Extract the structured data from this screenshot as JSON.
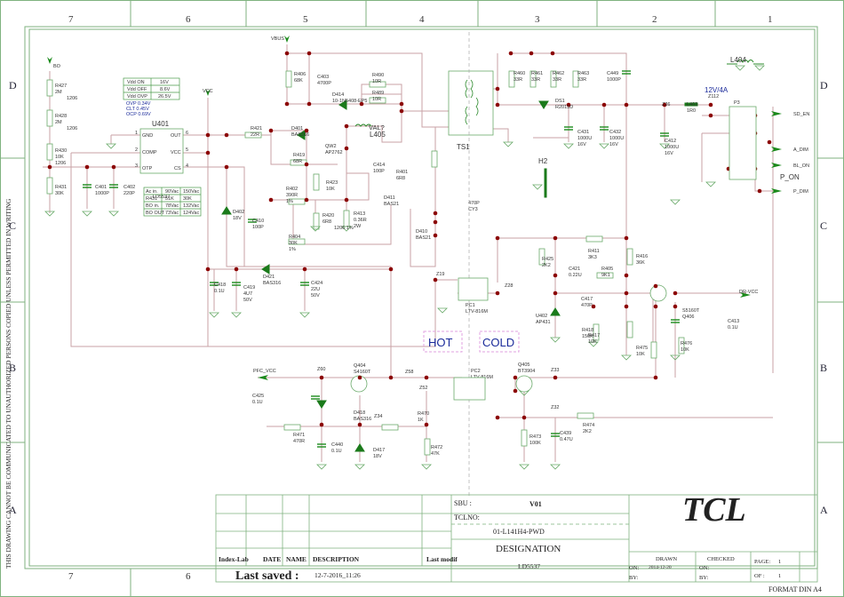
{
  "border": {
    "columns": [
      "7",
      "6",
      "5",
      "4",
      "3",
      "2",
      "1"
    ],
    "rows": [
      "D",
      "C",
      "B",
      "A"
    ],
    "side_notice": "THIS DRAWING CANNOT BE COMMUNICATED TO UNAUTHORIZED PERSONS COPIED UNLESS PERMITTED IN WRITING"
  },
  "nets": {
    "bo": "BO",
    "vbus": "VBUS",
    "vcc": "VCC",
    "pfc_vcc": "PFC_VCC",
    "dr_vcc": "DR-VCC",
    "sd_en": "SD_EN",
    "a_dim": "A_DIM",
    "bl_on": "BL_ON",
    "p_on": "P_ON",
    "p_dim": "P_DIM",
    "rail": "12V/4A",
    "val": "VAL?"
  },
  "regions": {
    "hot": "HOT",
    "cold": "COLD"
  },
  "ic": {
    "ref": "U401",
    "part": "LD5537",
    "pins_left": [
      {
        "num": "1",
        "name": "GND"
      },
      {
        "num": "2",
        "name": "COMP"
      },
      {
        "num": "3",
        "name": "OTP"
      }
    ],
    "pins_right": [
      {
        "num": "6",
        "name": "OUT"
      },
      {
        "num": "5",
        "name": "VCC"
      },
      {
        "num": "4",
        "name": "CS"
      }
    ]
  },
  "vdd_table": [
    [
      "Vdd ON",
      "16V"
    ],
    [
      "Vdd OFF",
      "8.6V"
    ],
    [
      "Vdd OVP",
      "26.5V"
    ]
  ],
  "protect_notes": [
    "OVP 0.34V",
    "CLT 0.45V",
    "OCP 0.69V"
  ],
  "bo_table": [
    [
      "Ac in.",
      "90Vac",
      "150Vac"
    ],
    [
      "R431",
      "51K",
      "30K"
    ],
    [
      "BO in.",
      "78Vac",
      "132Vac"
    ],
    [
      "BO OUT",
      "73Vac",
      "124Vac"
    ]
  ],
  "components": [
    {
      "ref": "R427",
      "value": "2M",
      "extra": "1206"
    },
    {
      "ref": "R428",
      "value": "2M",
      "extra": "1206"
    },
    {
      "ref": "R430",
      "value": "10K",
      "extra": "1206"
    },
    {
      "ref": "R431",
      "value": "30K"
    },
    {
      "ref": "C401",
      "value": "1000P"
    },
    {
      "ref": "C402",
      "value": "220P"
    },
    {
      "ref": "R421",
      "value": "22R"
    },
    {
      "ref": "D401",
      "value": "BAS316"
    },
    {
      "ref": "R419",
      "value": "68R"
    },
    {
      "ref": "QW2",
      "value": "AP2762"
    },
    {
      "ref": "C414",
      "value": "100P"
    },
    {
      "ref": "R402",
      "value": "390R",
      "extra": "1%"
    },
    {
      "ref": "R423",
      "value": "10K"
    },
    {
      "ref": "R420",
      "value": "6R8",
      "extra": "1206 1%"
    },
    {
      "ref": "R413",
      "value": "0.36R",
      "extra": "2W"
    },
    {
      "ref": "R404",
      "value": "30K",
      "extra": "1%"
    },
    {
      "ref": "R406",
      "value": "68K"
    },
    {
      "ref": "C403",
      "value": "4700P"
    },
    {
      "ref": "D414",
      "value": "10-1N5408-EP5"
    },
    {
      "ref": "R490",
      "value": "10R"
    },
    {
      "ref": "R489",
      "value": "10R"
    },
    {
      "ref": "L405",
      "value": ""
    },
    {
      "ref": "R401",
      "value": "6R8"
    },
    {
      "ref": "D411",
      "value": "BAS21"
    },
    {
      "ref": "D410",
      "value": "BAS21"
    },
    {
      "ref": "D402",
      "value": "18V"
    },
    {
      "ref": "C410",
      "value": "100P"
    },
    {
      "ref": "C418",
      "value": "0.1U"
    },
    {
      "ref": "C419",
      "value": "4U7",
      "extra": "50V"
    },
    {
      "ref": "D421",
      "value": "BAS316"
    },
    {
      "ref": "C424",
      "value": "22U",
      "extra": "50V"
    },
    {
      "ref": "TS1",
      "value": ""
    },
    {
      "ref": "470P",
      "value": "CY3"
    },
    {
      "ref": "H2",
      "value": ""
    },
    {
      "ref": "R460",
      "value": "33R"
    },
    {
      "ref": "R461",
      "value": "33R"
    },
    {
      "ref": "R462",
      "value": "33R"
    },
    {
      "ref": "R463",
      "value": "33R"
    },
    {
      "ref": "DS1",
      "value": "R2015D"
    },
    {
      "ref": "C449",
      "value": "1000P"
    },
    {
      "ref": "C431",
      "value": "1000U",
      "extra": "16V"
    },
    {
      "ref": "C432",
      "value": "1000U",
      "extra": "16V"
    },
    {
      "ref": "Z26",
      "value": ""
    },
    {
      "ref": "C412",
      "value": "1000U",
      "extra": "16V"
    },
    {
      "ref": "L403",
      "value": "1R0"
    },
    {
      "ref": "Z112",
      "value": ""
    },
    {
      "ref": "P3",
      "value": ""
    },
    {
      "ref": "L404",
      "value": ""
    },
    {
      "ref": "R411",
      "value": "3K3"
    },
    {
      "ref": "R425",
      "value": "2K2"
    },
    {
      "ref": "R416",
      "value": "36K"
    },
    {
      "ref": "C421",
      "value": "0.22U"
    },
    {
      "ref": "R405",
      "value": "9K1"
    },
    {
      "ref": "C417",
      "value": "470P"
    },
    {
      "ref": "U402",
      "value": "AP431"
    },
    {
      "ref": "R418",
      "value": "150K"
    },
    {
      "ref": "R417",
      "value": "10K"
    },
    {
      "ref": "R475",
      "value": "10K"
    },
    {
      "ref": "R476",
      "value": "10K"
    },
    {
      "ref": "S5160T",
      "value": "Q406"
    },
    {
      "ref": "C413",
      "value": "0.1U"
    },
    {
      "ref": "PC1",
      "value": "LTV-816M"
    },
    {
      "ref": "Z19",
      "value": ""
    },
    {
      "ref": "Z28",
      "value": ""
    },
    {
      "ref": "C425",
      "value": "0.1U"
    },
    {
      "ref": "Z60",
      "value": ""
    },
    {
      "ref": "Q404",
      "value": "S4160T"
    },
    {
      "ref": "D418",
      "value": "BAS316"
    },
    {
      "ref": "Z34",
      "value": ""
    },
    {
      "ref": "R470",
      "value": "1K"
    },
    {
      "ref": "R471",
      "value": "470R"
    },
    {
      "ref": "C440",
      "value": "0.1U"
    },
    {
      "ref": "D417",
      "value": "18V"
    },
    {
      "ref": "R472",
      "value": "47K"
    },
    {
      "ref": "Z58",
      "value": ""
    },
    {
      "ref": "Z52",
      "value": ""
    },
    {
      "ref": "PC2",
      "value": "LTV-816M"
    },
    {
      "ref": "Q405",
      "value": "BT3904"
    },
    {
      "ref": "Z33",
      "value": ""
    },
    {
      "ref": "Z32",
      "value": ""
    },
    {
      "ref": "R474",
      "value": "2K2"
    },
    {
      "ref": "R473",
      "value": "100K"
    },
    {
      "ref": "C439",
      "value": "0.47U"
    }
  ],
  "title_block": {
    "headers": [
      "Index-Lab",
      "DATE",
      "NAME",
      "DESCRIPTION",
      "Last modif"
    ],
    "last_saved_label": "Last saved :",
    "last_saved_value": "12-7-2016_11:26",
    "sbu_label": "SBU :",
    "sbu_value": "V01",
    "tclno_label": "TCLNO:",
    "tclno_value": "01-L141H4-PWD",
    "designation_label": "DESIGNATION",
    "designation_value": "LD5537",
    "logo": "TCL",
    "drawn_label": "DRAWN",
    "drawn_on_label": "ON:",
    "drawn_on_value": "2014-12-20",
    "drawn_by_label": "BY:",
    "checked_label": "CHECKED",
    "checked_on_label": "ON:",
    "checked_by_label": "BY:",
    "page_label": "PAGE:",
    "page_value": "1",
    "of_label": "OF :",
    "of_value": "1",
    "format": "FORMAT DIN A4"
  },
  "colors": {
    "wire": "#c9a2a6",
    "node": "#8b0000",
    "component": "#1b7a1b",
    "frame": "#7fb27f",
    "label_blue": "#1a2a9a"
  }
}
